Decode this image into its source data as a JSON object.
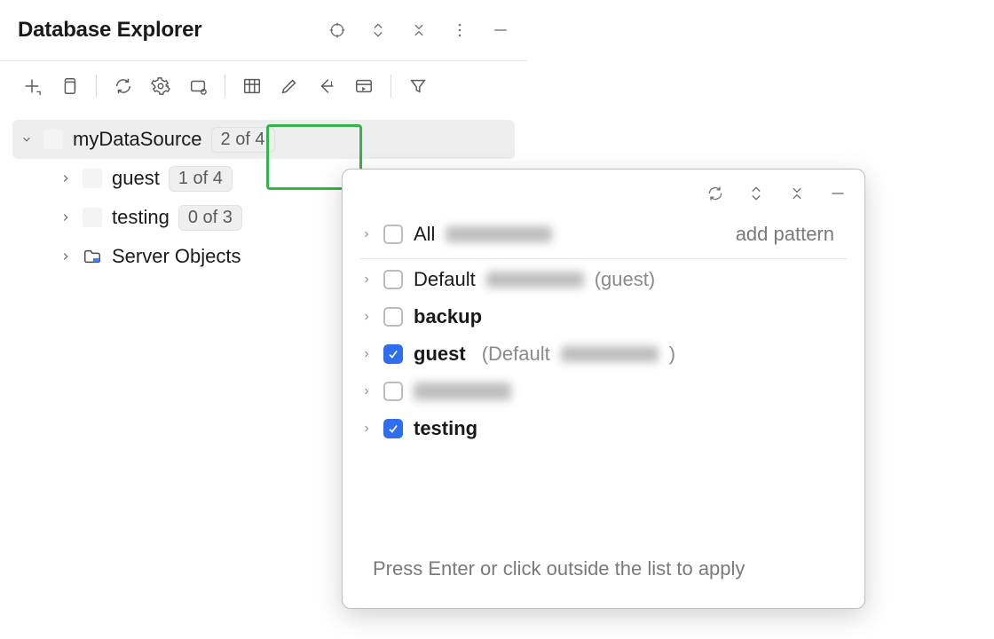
{
  "header": {
    "title": "Database Explorer"
  },
  "tree": {
    "datasource": {
      "label": "myDataSource",
      "badge": "2 of 4"
    },
    "items": [
      {
        "label": "guest",
        "badge": "1 of 4"
      },
      {
        "label": "testing",
        "badge": "0 of 3"
      },
      {
        "label": "Server Objects"
      }
    ]
  },
  "popup": {
    "rows": {
      "all": {
        "label": "All",
        "link": "add pattern"
      },
      "default": {
        "label": "Default",
        "suffix": "(guest)"
      },
      "backup": {
        "label": "backup"
      },
      "guest": {
        "label": "guest",
        "suffix_open": "(Default",
        "suffix_close": ")"
      },
      "testing": {
        "label": "testing"
      }
    },
    "footer": "Press Enter or click outside the list to apply"
  }
}
